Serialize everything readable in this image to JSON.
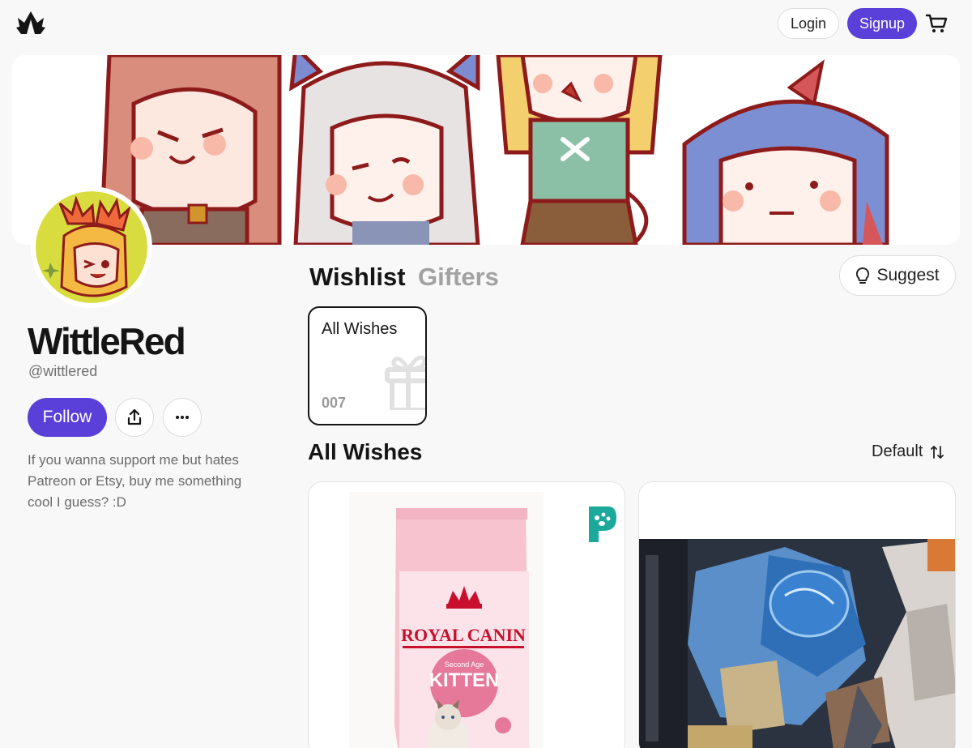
{
  "header": {
    "logo_icon": "crown-logo-icon",
    "login_label": "Login",
    "signup_label": "Signup",
    "cart_icon": "cart-icon"
  },
  "profile": {
    "name": "WittleRed",
    "handle": "@wittlered",
    "follow_label": "Follow",
    "share_icon": "share-icon",
    "more_icon": "more-icon",
    "bio": "If you wanna support me but hates Patreon or Etsy, buy me something cool I guess? :D"
  },
  "tabs": [
    {
      "label": "Wishlist",
      "active": true
    },
    {
      "label": "Gifters",
      "active": false
    }
  ],
  "suggest": {
    "label": "Suggest",
    "icon": "lightbulb-icon"
  },
  "list_card": {
    "title": "All Wishes",
    "count": "007",
    "icon": "gift-icon"
  },
  "wishes": {
    "title": "All Wishes",
    "sort_label": "Default",
    "sort_icon": "sort-icon"
  },
  "products": [
    {
      "brand": "ROYAL CANIN",
      "product": "KITTEN",
      "sub": "Second Age",
      "store_icon": "paw-store-icon"
    },
    {
      "name": "gundam-model-kit"
    }
  ],
  "colors": {
    "accent": "#5a3fd8",
    "text": "#151515",
    "muted": "#707070",
    "teal_badge": "#1aa99a"
  }
}
